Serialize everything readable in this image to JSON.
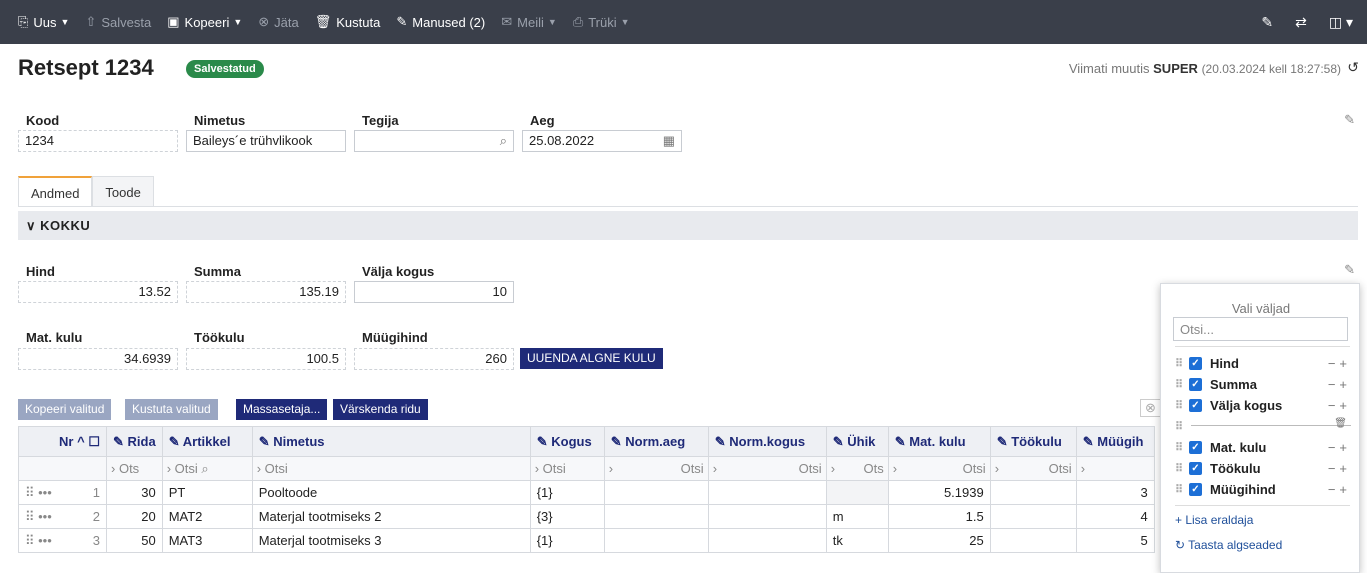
{
  "toolbar": {
    "new": "Uus",
    "save": "Salvesta",
    "copy": "Kopeeri",
    "cancel": "Jäta",
    "delete": "Kustuta",
    "attachments": "Manused (2)",
    "email": "Meili",
    "print": "Trüki"
  },
  "header": {
    "title": "Retsept 1234",
    "status": "Salvestatud",
    "lastmod_prefix": "Viimati muutis",
    "lastmod_user": "SUPER",
    "lastmod_time": "(20.03.2024 kell 18:27:58)"
  },
  "fields": {
    "kood_label": "Kood",
    "kood": "1234",
    "nimetus_label": "Nimetus",
    "nimetus": "Baileys´e trühvlikook",
    "tegija_label": "Tegija",
    "tegija": "",
    "aeg_label": "Aeg",
    "aeg": "25.08.2022"
  },
  "tabs": [
    "Andmed",
    "Toode"
  ],
  "section_title": "KOKKU",
  "totals": {
    "hind_label": "Hind",
    "hind": "13.52",
    "summa_label": "Summa",
    "summa": "135.19",
    "valja_label": "Välja kogus",
    "valja": "10",
    "mat_label": "Mat. kulu",
    "mat": "34.6939",
    "too_label": "Töökulu",
    "too": "100.5",
    "myygi_label": "Müügihind",
    "myygi": "260",
    "update_button": "UUENDA ALGNE KULU"
  },
  "row_actions": {
    "copy_selected": "Kopeeri valitud",
    "delete_selected": "Kustuta valitud",
    "mass_setter": "Massasetaja...",
    "refresh_rows": "Värskenda ridu"
  },
  "table": {
    "columns": [
      "Nr",
      "Rida",
      "Artikkel",
      "Nimetus",
      "Kogus",
      "Norm.aeg",
      "Norm.kogus",
      "Ühik",
      "Mat. kulu",
      "Töökulu",
      "Müügih"
    ],
    "filter_placeholder": "Otsi",
    "filter_short": "Ots",
    "rows": [
      {
        "nr": "1",
        "rida": "30",
        "artikkel": "PT",
        "nimetus": "Pooltoode",
        "kogus": "{1}",
        "normaeg": "",
        "normkogus": "",
        "yhik": "",
        "mat": "5.1939",
        "too": "",
        "myygi": "3"
      },
      {
        "nr": "2",
        "rida": "20",
        "artikkel": "MAT2",
        "nimetus": "Materjal tootmiseks 2",
        "kogus": "{3}",
        "normaeg": "",
        "normkogus": "",
        "yhik": "m",
        "mat": "1.5",
        "too": "",
        "myygi": "4"
      },
      {
        "nr": "3",
        "rida": "50",
        "artikkel": "MAT3",
        "nimetus": "Materjal tootmiseks 3",
        "kogus": "{1}",
        "normaeg": "",
        "normkogus": "",
        "yhik": "tk",
        "mat": "25",
        "too": "",
        "myygi": "5"
      }
    ]
  },
  "field_panel": {
    "title": "Vali väljad",
    "search_placeholder": "Otsi...",
    "group1": [
      "Hind",
      "Summa",
      "Välja kogus"
    ],
    "group2": [
      "Mat. kulu",
      "Töökulu",
      "Müügihind"
    ],
    "add_separator": "+ Lisa eraldaja",
    "restore_defaults": "Taasta algseaded"
  }
}
